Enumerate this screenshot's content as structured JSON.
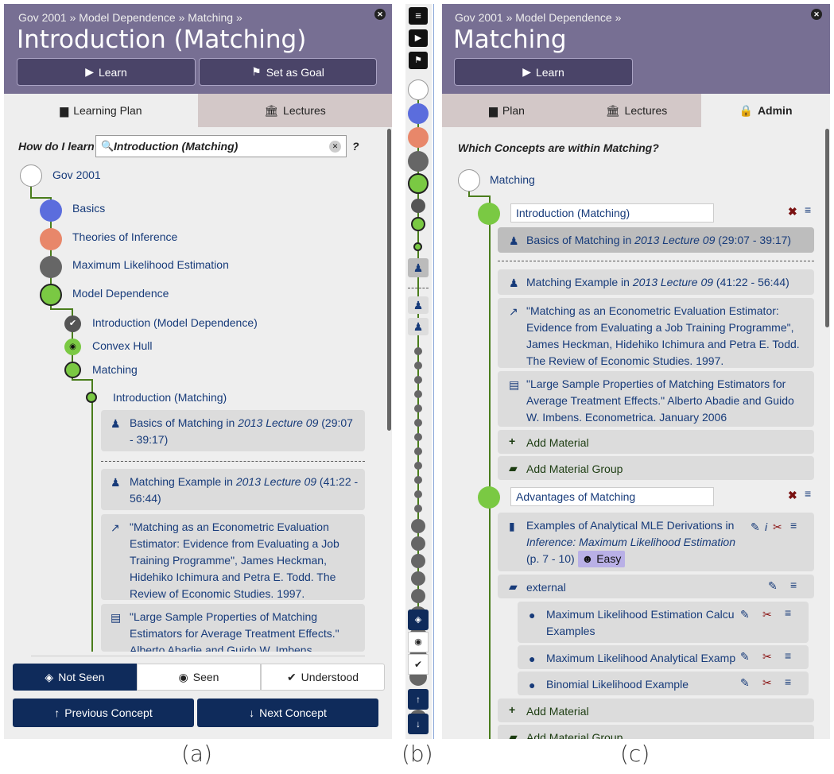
{
  "panel_a": {
    "breadcrumb": "Gov 2001 » Model Dependence » Matching »",
    "title": "Introduction (Matching)",
    "learn_label": "Learn",
    "goal_label": "Set as Goal",
    "tabs": [
      "Learning Plan",
      "Lectures"
    ],
    "question": "How do I learn",
    "search_value": "Introduction (Matching)",
    "question_mark": "?",
    "tree": [
      "Gov 2001",
      "Basics",
      "Theories of Inference",
      "Maximum Likelihood Estimation",
      "Model Dependence",
      "Introduction (Model Dependence)",
      "Convex Hull",
      "Matching",
      "Introduction (Matching)"
    ],
    "cards": [
      {
        "pre": "Basics of Matching in ",
        "em": "2013 Lecture 09",
        "post": " (29:07 - 39:17)"
      },
      {
        "pre": "Matching Example in ",
        "em": "2013 Lecture 09",
        "post": " (41:22 - 56:44)"
      },
      {
        "text": "\"Matching as an Econometric Evaluation Estimator: Evidence from Evaluating a Job Training Programme\", James Heckman, Hidehiko Ichimura and Petra E. Todd. The Review of Economic Studies. 1997."
      },
      {
        "text": "\"Large Sample Properties of Matching Estimators for Average Treatment Effects.\" Alberto Abadie and Guido W. Imbens."
      }
    ],
    "status": [
      "Not Seen",
      "Seen",
      "Understood"
    ],
    "prev_label": "Previous Concept",
    "next_label": "Next Concept",
    "caption": "(a)"
  },
  "panel_b": {
    "caption": "(b)"
  },
  "panel_c": {
    "breadcrumb": "Gov 2001 » Model Dependence »",
    "title": "Matching",
    "learn_label": "Learn",
    "tabs": [
      "Plan",
      "Lectures",
      "Admin"
    ],
    "question": "Which Concepts are within Matching?",
    "root": "Matching",
    "concept1": "Introduction (Matching)",
    "c1_cards": [
      {
        "pre": "Basics of Matching in ",
        "em": "2013 Lecture 09",
        "post": " (29:07 - 39:17)"
      },
      {
        "pre": "Matching Example in ",
        "em": "2013 Lecture 09",
        "post": " (41:22 - 56:44)"
      },
      {
        "text": "\"Matching as an Econometric Evaluation Estimator: Evidence from Evaluating a Job Training Programme\", James Heckman, Hidehiko Ichimura and Petra E. Todd. The Review of Economic Studies. 1997."
      },
      {
        "text": "\"Large Sample Properties of Matching Estimators for Average Treatment Effects.\" Alberto Abadie and Guido W. Imbens. Econometrica. January 2006"
      }
    ],
    "add_material": "Add Material",
    "add_group": "Add Material Group",
    "concept2": "Advantages of Matching",
    "book_card": {
      "pre": "Examples of Analytical MLE Derivations in ",
      "em": "Inference: Maximum Likelihood Estimation",
      "post": " (p. 7 - 10)",
      "badge": "Easy"
    },
    "group_label": "external",
    "links": [
      "Maximum Likelihood Estimation Calcu Examples",
      "Maximum Likelihood Analytical Examp",
      "Binomial Likelihood Example"
    ],
    "caption": "(c)"
  },
  "colors": {
    "header": "#776f93",
    "button": "#4a4468",
    "link": "#173b7a",
    "green": "#7ac943",
    "blue": "#5b6ddd",
    "salmon": "#e8876a",
    "gray": "#666666",
    "navy": "#0f2b5b"
  }
}
